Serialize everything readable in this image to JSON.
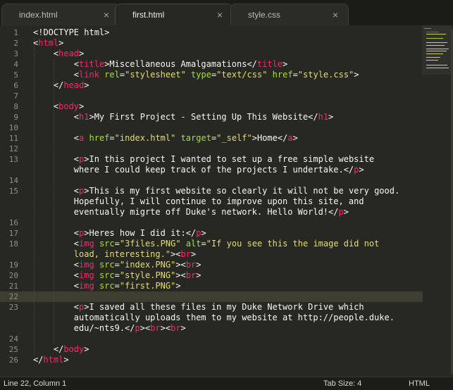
{
  "tabs": [
    {
      "label": "index.html",
      "close": "×",
      "active": false
    },
    {
      "label": "first.html",
      "close": "×",
      "active": true
    },
    {
      "label": "style.css",
      "close": "×",
      "active": false
    }
  ],
  "line_numbers": [
    "1",
    "2",
    "3",
    "4",
    "5",
    "6",
    "7",
    "8",
    "9",
    "10",
    "11",
    "12",
    "13",
    "",
    "14",
    "15",
    "",
    "",
    "16",
    "17",
    "18",
    "",
    "19",
    "20",
    "21",
    "22",
    "23",
    "",
    "",
    "24",
    "25",
    "26"
  ],
  "code_lines": [
    {
      "tokens": [
        {
          "t": "tx",
          "v": "<!DOCTYPE html>"
        }
      ]
    },
    {
      "tokens": [
        {
          "t": "tx",
          "v": "<"
        },
        {
          "t": "tg",
          "v": "html"
        },
        {
          "t": "tx",
          "v": ">"
        }
      ]
    },
    {
      "tokens": [
        {
          "t": "tx",
          "v": "    <"
        },
        {
          "t": "tg",
          "v": "head"
        },
        {
          "t": "tx",
          "v": ">"
        }
      ]
    },
    {
      "tokens": [
        {
          "t": "tx",
          "v": "        <"
        },
        {
          "t": "tg",
          "v": "title"
        },
        {
          "t": "tx",
          "v": ">Miscellaneous Amalgamations</"
        },
        {
          "t": "tg",
          "v": "title"
        },
        {
          "t": "tx",
          "v": ">"
        }
      ]
    },
    {
      "tokens": [
        {
          "t": "tx",
          "v": "        <"
        },
        {
          "t": "tg",
          "v": "link"
        },
        {
          "t": "tx",
          "v": " "
        },
        {
          "t": "at",
          "v": "rel"
        },
        {
          "t": "tx",
          "v": "="
        },
        {
          "t": "st",
          "v": "\"stylesheet\""
        },
        {
          "t": "tx",
          "v": " "
        },
        {
          "t": "at",
          "v": "type"
        },
        {
          "t": "tx",
          "v": "="
        },
        {
          "t": "st",
          "v": "\"text/css\""
        },
        {
          "t": "tx",
          "v": " "
        },
        {
          "t": "at",
          "v": "href"
        },
        {
          "t": "tx",
          "v": "="
        },
        {
          "t": "st",
          "v": "\"style.css\""
        },
        {
          "t": "tx",
          "v": ">"
        }
      ]
    },
    {
      "tokens": [
        {
          "t": "tx",
          "v": "    </"
        },
        {
          "t": "tg",
          "v": "head"
        },
        {
          "t": "tx",
          "v": ">"
        }
      ]
    },
    {
      "tokens": []
    },
    {
      "tokens": [
        {
          "t": "tx",
          "v": "    <"
        },
        {
          "t": "tg",
          "v": "body"
        },
        {
          "t": "tx",
          "v": ">"
        }
      ]
    },
    {
      "tokens": [
        {
          "t": "tx",
          "v": "        <"
        },
        {
          "t": "tg",
          "v": "h1"
        },
        {
          "t": "tx",
          "v": ">My First Project - Setting Up This Website</"
        },
        {
          "t": "tg",
          "v": "h1"
        },
        {
          "t": "tx",
          "v": ">"
        }
      ]
    },
    {
      "tokens": []
    },
    {
      "tokens": [
        {
          "t": "tx",
          "v": "        <"
        },
        {
          "t": "tg",
          "v": "a"
        },
        {
          "t": "tx",
          "v": " "
        },
        {
          "t": "at",
          "v": "href"
        },
        {
          "t": "tx",
          "v": "="
        },
        {
          "t": "st",
          "v": "\"index.html\""
        },
        {
          "t": "tx",
          "v": " "
        },
        {
          "t": "at",
          "v": "target"
        },
        {
          "t": "tx",
          "v": "="
        },
        {
          "t": "st",
          "v": "\"_self\""
        },
        {
          "t": "tx",
          "v": ">Home</"
        },
        {
          "t": "tg",
          "v": "a"
        },
        {
          "t": "tx",
          "v": ">"
        }
      ]
    },
    {
      "tokens": []
    },
    {
      "tokens": [
        {
          "t": "tx",
          "v": "        <"
        },
        {
          "t": "tg",
          "v": "p"
        },
        {
          "t": "tx",
          "v": ">In this project I wanted to set up a free simple website"
        }
      ]
    },
    {
      "tokens": [
        {
          "t": "tx",
          "v": "        where I could keep track of the projects I undertake.</"
        },
        {
          "t": "tg",
          "v": "p"
        },
        {
          "t": "tx",
          "v": ">"
        }
      ]
    },
    {
      "tokens": []
    },
    {
      "tokens": [
        {
          "t": "tx",
          "v": "        <"
        },
        {
          "t": "tg",
          "v": "p"
        },
        {
          "t": "tx",
          "v": ">This is my first website so clearly it will not be very good."
        }
      ]
    },
    {
      "tokens": [
        {
          "t": "tx",
          "v": "        Hopefully, I will continue to improve upon this site, and"
        }
      ]
    },
    {
      "tokens": [
        {
          "t": "tx",
          "v": "        eventually migrte off Duke's network. Hello World!</"
        },
        {
          "t": "tg",
          "v": "p"
        },
        {
          "t": "tx",
          "v": ">"
        }
      ]
    },
    {
      "tokens": []
    },
    {
      "tokens": [
        {
          "t": "tx",
          "v": "        <"
        },
        {
          "t": "tg",
          "v": "p"
        },
        {
          "t": "tx",
          "v": ">Heres how I did it:</"
        },
        {
          "t": "tg",
          "v": "p"
        },
        {
          "t": "tx",
          "v": ">"
        }
      ]
    },
    {
      "tokens": [
        {
          "t": "tx",
          "v": "        <"
        },
        {
          "t": "tg",
          "v": "img"
        },
        {
          "t": "tx",
          "v": " "
        },
        {
          "t": "at",
          "v": "src"
        },
        {
          "t": "tx",
          "v": "="
        },
        {
          "t": "st",
          "v": "\"3files.PNG\""
        },
        {
          "t": "tx",
          "v": " "
        },
        {
          "t": "at",
          "v": "alt"
        },
        {
          "t": "tx",
          "v": "="
        },
        {
          "t": "st",
          "v": "\"If you see this the image did not"
        }
      ]
    },
    {
      "tokens": [
        {
          "t": "st",
          "v": "        load, interesting.\""
        },
        {
          "t": "tx",
          "v": "><"
        },
        {
          "t": "tg",
          "v": "br"
        },
        {
          "t": "tx",
          "v": ">"
        }
      ]
    },
    {
      "tokens": [
        {
          "t": "tx",
          "v": "        <"
        },
        {
          "t": "tg",
          "v": "img"
        },
        {
          "t": "tx",
          "v": " "
        },
        {
          "t": "at",
          "v": "src"
        },
        {
          "t": "tx",
          "v": "="
        },
        {
          "t": "st",
          "v": "\"index.PNG\""
        },
        {
          "t": "tx",
          "v": "><"
        },
        {
          "t": "tg",
          "v": "br"
        },
        {
          "t": "tx",
          "v": ">"
        }
      ]
    },
    {
      "tokens": [
        {
          "t": "tx",
          "v": "        <"
        },
        {
          "t": "tg",
          "v": "img"
        },
        {
          "t": "tx",
          "v": " "
        },
        {
          "t": "at",
          "v": "src"
        },
        {
          "t": "tx",
          "v": "="
        },
        {
          "t": "st",
          "v": "\"style.PNG\""
        },
        {
          "t": "tx",
          "v": "><"
        },
        {
          "t": "tg",
          "v": "br"
        },
        {
          "t": "tx",
          "v": ">"
        }
      ]
    },
    {
      "tokens": [
        {
          "t": "tx",
          "v": "        <"
        },
        {
          "t": "tg",
          "v": "img"
        },
        {
          "t": "tx",
          "v": " "
        },
        {
          "t": "at",
          "v": "src"
        },
        {
          "t": "tx",
          "v": "="
        },
        {
          "t": "st",
          "v": "\"first.PNG\""
        },
        {
          "t": "tx",
          "v": ">"
        }
      ]
    },
    {
      "tokens": []
    },
    {
      "tokens": [
        {
          "t": "tx",
          "v": "        <"
        },
        {
          "t": "tg",
          "v": "p"
        },
        {
          "t": "tx",
          "v": ">I saved all these files in my Duke Network Drive which"
        }
      ]
    },
    {
      "tokens": [
        {
          "t": "tx",
          "v": "        automatically uploads them to my website at http://people.duke."
        }
      ]
    },
    {
      "tokens": [
        {
          "t": "tx",
          "v": "        edu/~nts9.</"
        },
        {
          "t": "tg",
          "v": "p"
        },
        {
          "t": "tx",
          "v": "><"
        },
        {
          "t": "tg",
          "v": "br"
        },
        {
          "t": "tx",
          "v": "><"
        },
        {
          "t": "tg",
          "v": "br"
        },
        {
          "t": "tx",
          "v": ">"
        }
      ]
    },
    {
      "tokens": []
    },
    {
      "tokens": [
        {
          "t": "tx",
          "v": "    </"
        },
        {
          "t": "tg",
          "v": "body"
        },
        {
          "t": "tx",
          "v": ">"
        }
      ]
    },
    {
      "tokens": [
        {
          "t": "tx",
          "v": "</"
        },
        {
          "t": "tg",
          "v": "html"
        },
        {
          "t": "tx",
          "v": ">"
        }
      ]
    }
  ],
  "current_line_index": 25,
  "status": {
    "position": "Line 22, Column 1",
    "tab_size": "Tab Size: 4",
    "syntax": "HTML"
  },
  "colors": {
    "background": "#272822",
    "tag": "#f92672",
    "attribute": "#a6e22e",
    "string": "#e6db74",
    "text": "#f8f8f2"
  }
}
